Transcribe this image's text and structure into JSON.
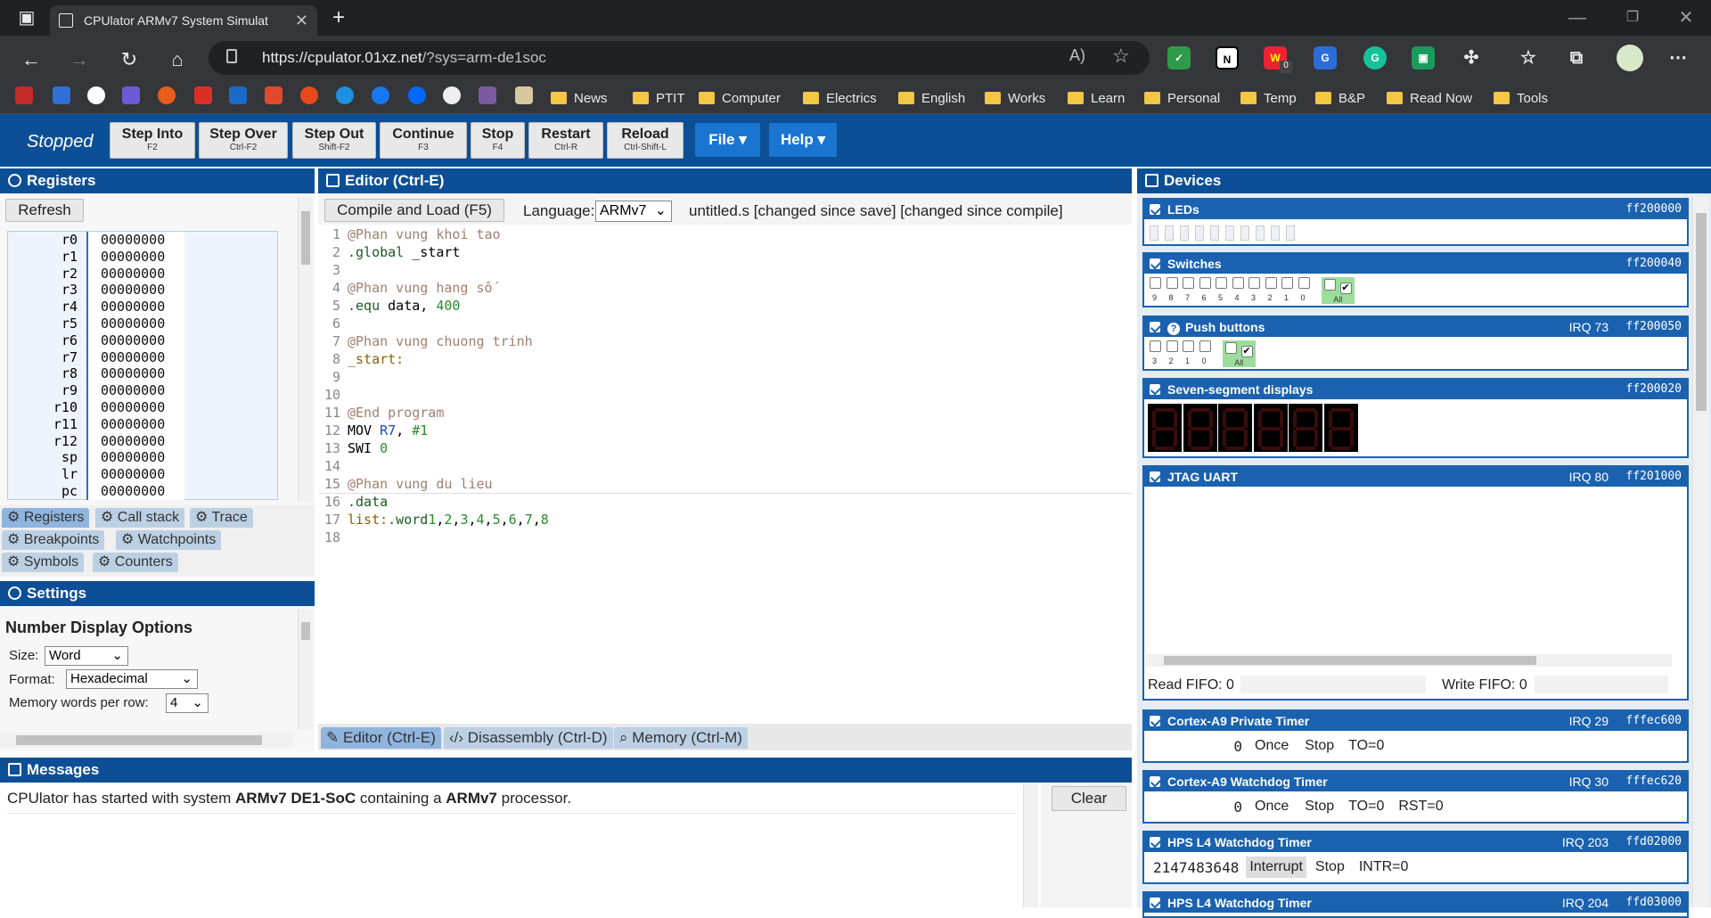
{
  "browser": {
    "tab_title": "CPUlator ARMv7 System Simulat",
    "url_host": "https://cpulator.01xz.net",
    "url_path": "/?sys=arm-de1soc",
    "extension_badge": "0",
    "bookmark_folders": [
      "News",
      "PTIT",
      "Computer",
      "Electrics",
      "English",
      "Works",
      "Learn",
      "Personal",
      "Temp",
      "B&P",
      "Read Now",
      "Tools"
    ]
  },
  "toolbar": {
    "state": "Stopped",
    "buttons": [
      {
        "label": "Step Into",
        "key": "F2"
      },
      {
        "label": "Step Over",
        "key": "Ctrl-F2"
      },
      {
        "label": "Step Out",
        "key": "Shift-F2"
      },
      {
        "label": "Continue",
        "key": "F3"
      },
      {
        "label": "Stop",
        "key": "F4"
      },
      {
        "label": "Restart",
        "key": "Ctrl-R"
      },
      {
        "label": "Reload",
        "key": "Ctrl-Shift-L"
      }
    ],
    "file_menu": "File",
    "help_menu": "Help"
  },
  "registers": {
    "title": "Registers",
    "refresh": "Refresh",
    "rows": [
      {
        "name": "r0",
        "value": "00000000"
      },
      {
        "name": "r1",
        "value": "00000000"
      },
      {
        "name": "r2",
        "value": "00000000"
      },
      {
        "name": "r3",
        "value": "00000000"
      },
      {
        "name": "r4",
        "value": "00000000"
      },
      {
        "name": "r5",
        "value": "00000000"
      },
      {
        "name": "r6",
        "value": "00000000"
      },
      {
        "name": "r7",
        "value": "00000000"
      },
      {
        "name": "r8",
        "value": "00000000"
      },
      {
        "name": "r9",
        "value": "00000000"
      },
      {
        "name": "r10",
        "value": "00000000"
      },
      {
        "name": "r11",
        "value": "00000000"
      },
      {
        "name": "r12",
        "value": "00000000"
      },
      {
        "name": "sp",
        "value": "00000000"
      },
      {
        "name": "lr",
        "value": "00000000"
      },
      {
        "name": "pc",
        "value": "00000000"
      }
    ],
    "tabs": [
      "Registers",
      "Call stack",
      "Trace",
      "Breakpoints",
      "Watchpoints",
      "Symbols",
      "Counters"
    ]
  },
  "settings": {
    "title": "Settings",
    "section": "Number Display Options",
    "size_label": "Size:",
    "size_value": "Word",
    "format_label": "Format:",
    "format_value": "Hexadecimal",
    "mem_label": "Memory words per row:",
    "mem_value": "4"
  },
  "editor": {
    "title": "Editor (Ctrl-E)",
    "compile_button": "Compile and Load (F5)",
    "language_label": "Language:",
    "language_value": "ARMv7",
    "file_status": "untitled.s [changed since save] [changed since compile]",
    "tabs": [
      "Editor (Ctrl-E)",
      "Disassembly (Ctrl-D)",
      "Memory (Ctrl-M)"
    ]
  },
  "messages": {
    "title": "Messages",
    "text_1": "CPUlator has started with system ",
    "system": "ARMv7 DE1-SoC",
    "text_2": " containing a ",
    "proc": "ARMv7",
    "text_3": " processor.",
    "clear": "Clear"
  },
  "devices": {
    "title": "Devices",
    "leds": {
      "name": "LEDs",
      "addr": "ff200000"
    },
    "switches": {
      "name": "Switches",
      "addr": "ff200040",
      "labels": [
        "9",
        "8",
        "7",
        "6",
        "5",
        "4",
        "3",
        "2",
        "1",
        "0"
      ],
      "all": "All"
    },
    "push": {
      "name": "Push buttons",
      "irq": "IRQ 73",
      "addr": "ff200050",
      "labels": [
        "3",
        "2",
        "1",
        "0"
      ],
      "all": "All"
    },
    "seven": {
      "name": "Seven-segment displays",
      "addr": "ff200020"
    },
    "jtag": {
      "name": "JTAG UART",
      "irq": "IRQ 80",
      "addr": "ff201000",
      "read": "Read FIFO: 0",
      "write": "Write FIFO: 0"
    },
    "a9timer": {
      "name": "Cortex-A9 Private Timer",
      "irq": "IRQ 29",
      "addr": "fffec600",
      "count": "0",
      "mode": "Once",
      "stop": "Stop",
      "to": "TO=0"
    },
    "a9wdt": {
      "name": "Cortex-A9 Watchdog Timer",
      "irq": "IRQ 30",
      "addr": "fffec620",
      "count": "0",
      "mode": "Once",
      "stop": "Stop",
      "to": "TO=0",
      "rst": "RST=0"
    },
    "hpswdt": {
      "name": "HPS L4 Watchdog Timer",
      "irq": "IRQ 203",
      "addr": "ffd02000",
      "count": "2147483648",
      "mode": "Interrupt",
      "stop": "Stop",
      "intr": "INTR=0"
    },
    "hpswdt2": {
      "name": "HPS L4 Watchdog Timer",
      "irq": "IRQ 204",
      "addr": "ffd03000"
    }
  }
}
